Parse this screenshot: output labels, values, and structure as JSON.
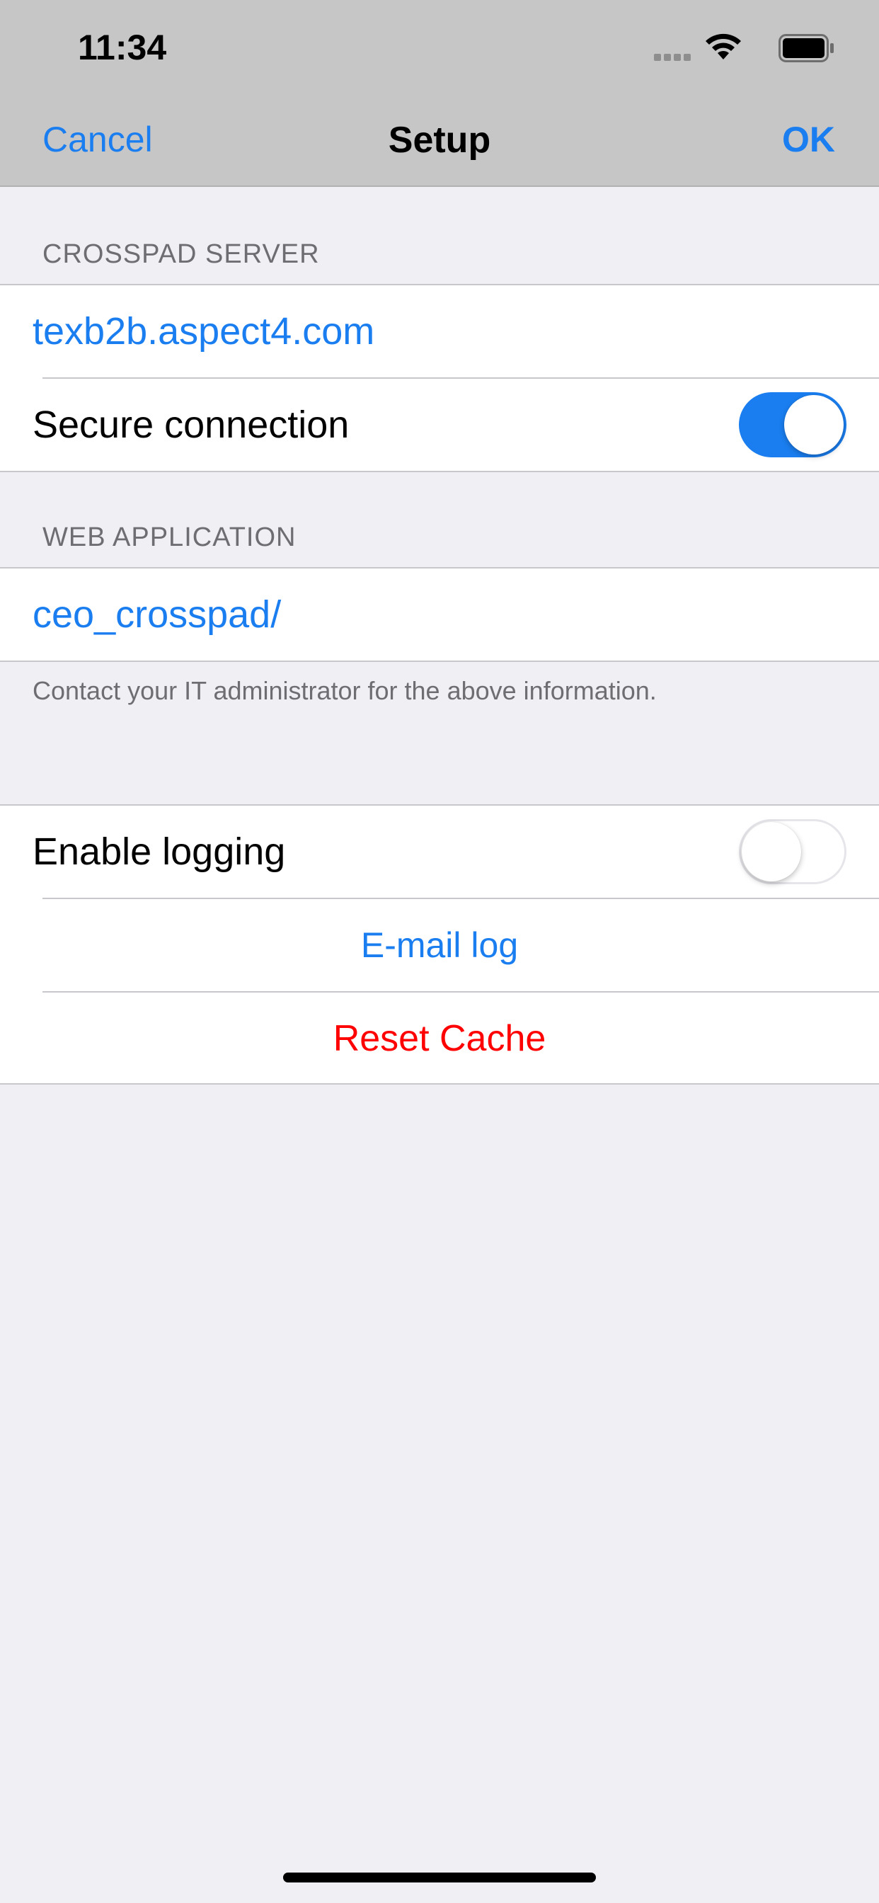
{
  "status_bar": {
    "time": "11:34",
    "icons": [
      "signal-icon",
      "wifi-icon",
      "battery-icon"
    ]
  },
  "nav": {
    "cancel_label": "Cancel",
    "title": "Setup",
    "ok_label": "OK"
  },
  "crosspad_server": {
    "header": "CROSSPAD SERVER",
    "server_value": "texb2b.aspect4.com",
    "secure_label": "Secure connection",
    "secure_enabled": true
  },
  "web_application": {
    "header": "WEB APPLICATION",
    "app_value": "ceo_crosspad/",
    "footer": "Contact your IT administrator for the above information."
  },
  "logging": {
    "enable_label": "Enable logging",
    "logging_enabled": false,
    "email_log_label": "E-mail log",
    "reset_cache_label": "Reset Cache"
  },
  "colors": {
    "accent": "#1a7ef0",
    "destructive": "#ff0000",
    "background": "#efeff4",
    "nav_bar": "#c6c6c6"
  }
}
